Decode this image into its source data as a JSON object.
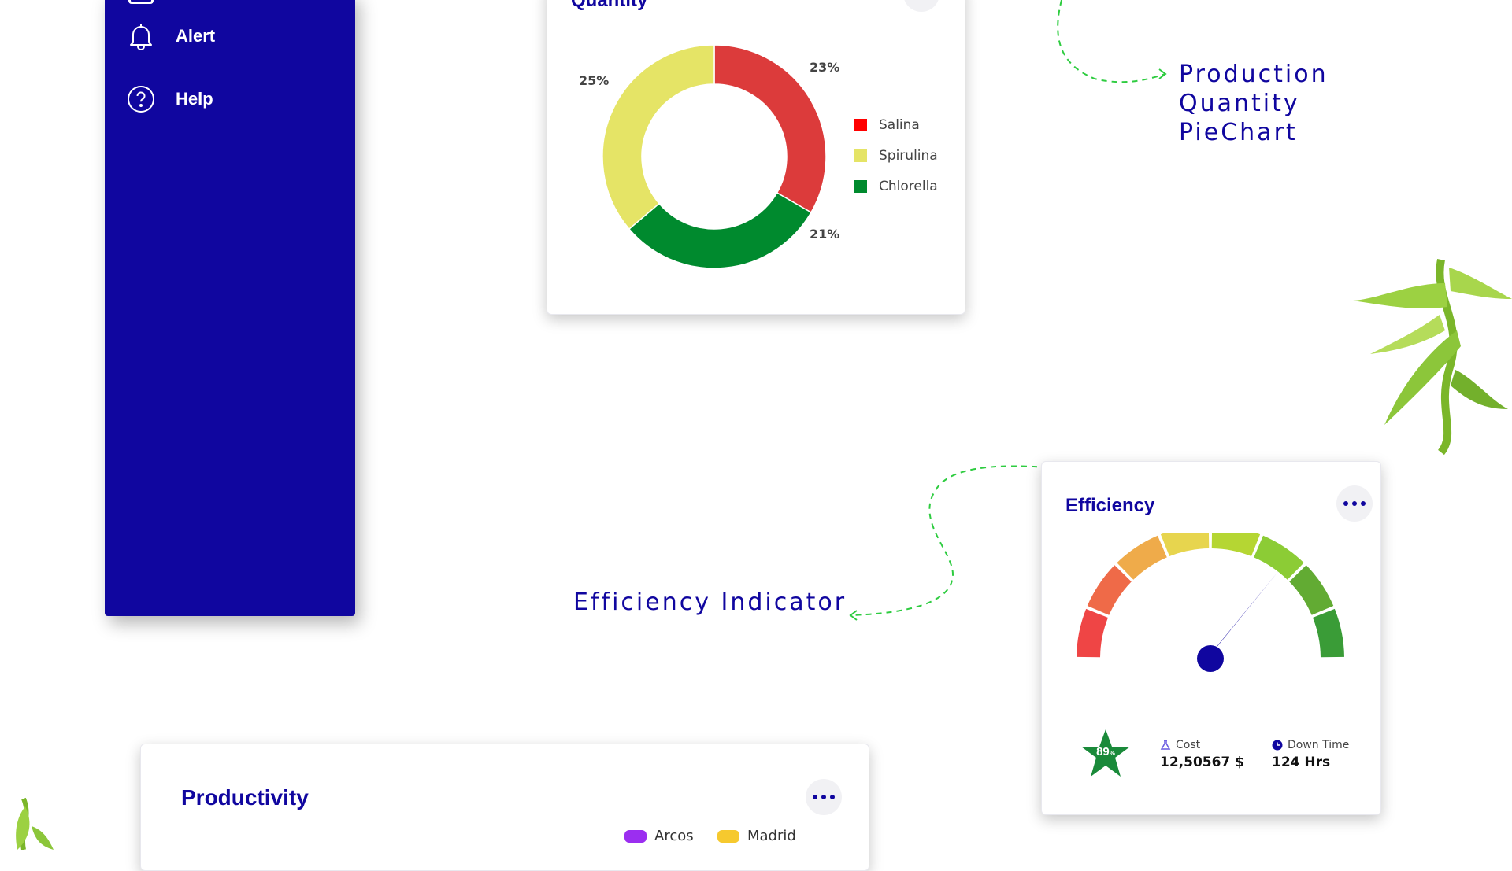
{
  "sidebar": {
    "items": [
      {
        "label": "Alert",
        "icon": "bell-icon"
      },
      {
        "label": "Help",
        "icon": "help-circle-icon"
      }
    ]
  },
  "quantity_card": {
    "title": "Quantity",
    "chart_data": {
      "type": "pie",
      "style": "donut",
      "series": [
        {
          "name": "Salina",
          "value": 23,
          "label": "23%",
          "color": "#dc3b3b"
        },
        {
          "name": "Chlorella",
          "value": 21,
          "label": "21%",
          "color": "#008a2e"
        },
        {
          "name": "Spirulina",
          "value": 25,
          "label": "25%",
          "color": "#e5e466"
        }
      ],
      "legend_placement": "right",
      "legend": [
        {
          "name": "Salina",
          "color": "#ff0000"
        },
        {
          "name": "Spirulina",
          "color": "#e5e466"
        },
        {
          "name": "Chlorella",
          "color": "#008a2e"
        }
      ]
    }
  },
  "annotations": {
    "production_pie": "Production Quantity PieChart",
    "efficiency_indicator": "Efficiency Indicator"
  },
  "efficiency_card": {
    "title": "Efficiency",
    "gauge": {
      "segments_colors": [
        "#ef4545",
        "#ef6a48",
        "#efab4a",
        "#e7d54e",
        "#b5d633",
        "#8ccc35",
        "#62ab33",
        "#3a9c37"
      ],
      "needle_color": "#10069f"
    },
    "rating": {
      "value": "89",
      "suffix": "%",
      "color": "#1a8a3a"
    },
    "cost": {
      "label": "Cost",
      "value": "12,50567 $",
      "icon": "flask-icon"
    },
    "downtime": {
      "label": "Down Time",
      "value": "124 Hrs",
      "icon": "clock-icon"
    }
  },
  "productivity_card": {
    "title": "Productivity",
    "legend": [
      {
        "name": "Arcos",
        "color": "#9b2ef0"
      },
      {
        "name": "Madrid",
        "color": "#f6c92e"
      }
    ]
  },
  "colors": {
    "brand": "#10069f",
    "accent_green": "#2ecc40"
  }
}
